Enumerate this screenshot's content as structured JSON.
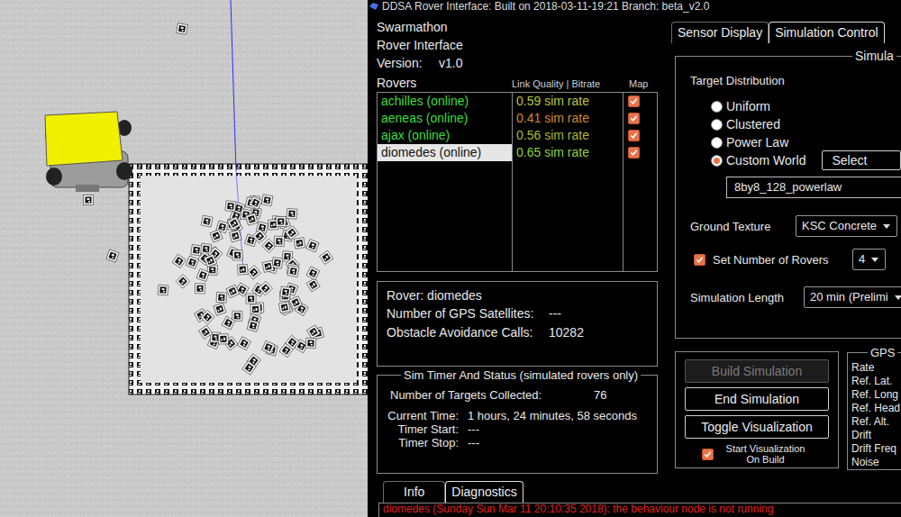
{
  "window": {
    "title": "DDSA Rover Interface: Built on 2018-03-11-19:21 Branch: beta_v2.0"
  },
  "header": {
    "app": "Swarmathon",
    "subtitle": "Rover Interface",
    "version_label": "Version:",
    "version": "v1.0"
  },
  "rovers": {
    "label": "Rovers",
    "columns": [
      "Link Quality | Bitrate",
      "Map"
    ],
    "items": [
      {
        "name": "achilles (online)",
        "rate": "0.59 sim rate",
        "color": "#b8c634",
        "map": true,
        "selected": false
      },
      {
        "name": "aeneas (online)",
        "rate": "0.41 sim rate",
        "color": "#d08c2c",
        "map": true,
        "selected": false
      },
      {
        "name": "ajax (online)",
        "rate": "0.56 sim rate",
        "color": "#aab834",
        "map": true,
        "selected": false
      },
      {
        "name": "diomedes (online)",
        "rate": "0.65 sim rate",
        "color": "#8fcf3a",
        "map": true,
        "selected": true
      }
    ]
  },
  "rover_info": {
    "title": "Rover: diomedes",
    "fields": [
      {
        "label": "Number of GPS Satellites:",
        "value": "---"
      },
      {
        "label": "Obstacle Avoidance Calls:",
        "value": "10282"
      }
    ]
  },
  "sim_status": {
    "title": "Sim Timer And Status (simulated rovers only)",
    "fields": [
      {
        "label": "Number of Targets Collected:",
        "value": "76"
      },
      {
        "label": "Current Time:",
        "value": "1 hours, 24 minutes, 58 seconds"
      },
      {
        "label": "Timer Start:",
        "value": "---"
      },
      {
        "label": "Timer Stop:",
        "value": "---"
      }
    ]
  },
  "right_tabs": [
    {
      "label": "Sensor Display",
      "selected": false
    },
    {
      "label": "Simulation Control",
      "selected": true
    }
  ],
  "simulation": {
    "title": "Simula",
    "target_distribution": {
      "label": "Target Distribution",
      "options": [
        {
          "label": "Uniform",
          "selected": false
        },
        {
          "label": "Clustered",
          "selected": false
        },
        {
          "label": "Power Law",
          "selected": false
        },
        {
          "label": "Custom World",
          "selected": true
        }
      ],
      "select_button": "Select",
      "world": "8by8_128_powerlaw"
    },
    "ground_texture": {
      "label": "Ground Texture",
      "value": "KSC Concrete"
    },
    "rover_count": {
      "label": "Set Number of Rovers",
      "checked": true,
      "value": "4"
    },
    "length": {
      "label": "Simulation Length",
      "value": "20 min (Prelimi"
    }
  },
  "controls": {
    "buttons": [
      {
        "label": "Build Simulation",
        "disabled": true
      },
      {
        "label": "End Simulation",
        "disabled": false
      },
      {
        "label": "Toggle Visualization",
        "disabled": false
      }
    ],
    "visualize_on_build": {
      "label": "Start Visualization On Build",
      "checked": true
    }
  },
  "gps": {
    "title": "GPS",
    "fields": [
      "Rate",
      "Ref. Lat.",
      "Ref. Long",
      "Ref. Head",
      "Ref. Alt.",
      "Drift",
      "Drift Freq",
      "Noise"
    ]
  },
  "log_tabs": [
    {
      "label": "Info",
      "selected": false
    },
    {
      "label": "Diagnostics",
      "selected": true
    }
  ],
  "log": {
    "lines": [
      {
        "text": "diomedes (Sunday Sun Mar 11 20:10:35 2018): the behaviour node is not running",
        "color": "#e02020"
      }
    ]
  }
}
